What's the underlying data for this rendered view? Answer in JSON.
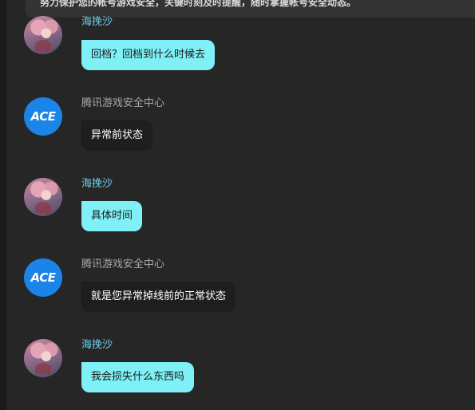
{
  "banner": {
    "text": "努力保护您的帐号游戏安全，关键时刻及时提醒，随时掌握帐号安全动态。"
  },
  "icons": {
    "user_avatar": "anime-girl-avatar",
    "system_avatar": "ace-logo-avatar"
  },
  "colors": {
    "user_bubble": "#7ff0f6",
    "system_bubble": "#1e1e1e",
    "user_name": "#6fd0f0",
    "system_name": "#a9a9a9",
    "background": "#262626",
    "ace_logo": "#1a84e8"
  },
  "messages": [
    {
      "role": "user",
      "sender": "海挽沙",
      "text": "回档？回档到什么时候去"
    },
    {
      "role": "system",
      "sender": "腾讯游戏安全中心",
      "logo_text": "ACE",
      "text": "异常前状态"
    },
    {
      "role": "user",
      "sender": "海挽沙",
      "text": "具体时间"
    },
    {
      "role": "system",
      "sender": "腾讯游戏安全中心",
      "logo_text": "ACE",
      "text": "就是您异常掉线前的正常状态"
    },
    {
      "role": "user",
      "sender": "海挽沙",
      "text": "我会损失什么东西吗"
    }
  ]
}
